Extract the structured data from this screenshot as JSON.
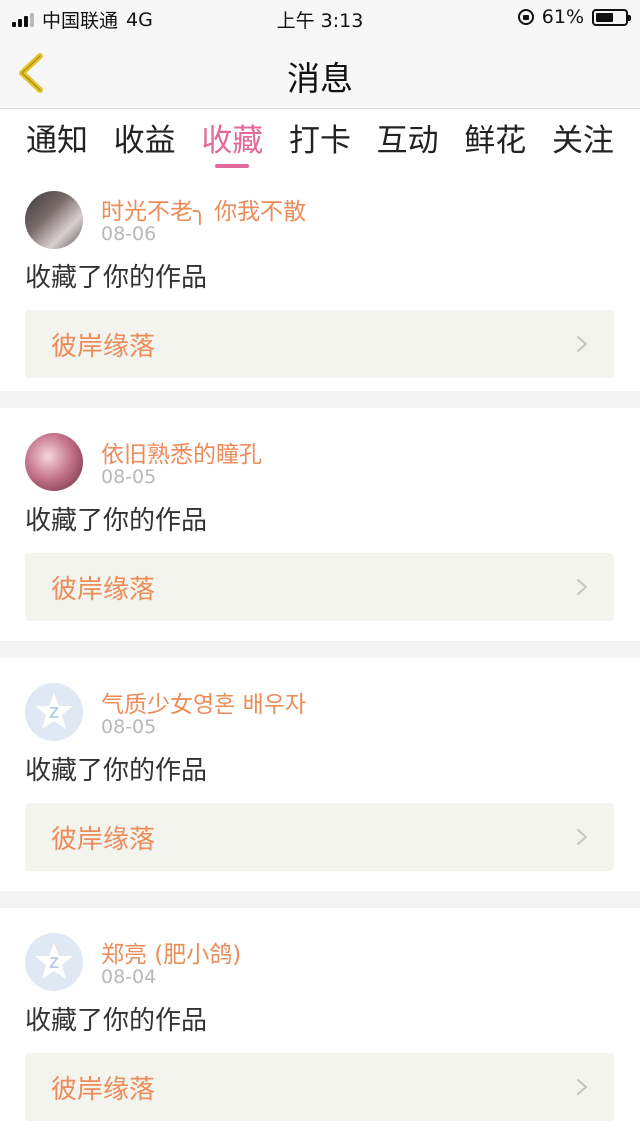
{
  "status": {
    "carrier": "中国联通",
    "network": "4G",
    "time": "上午 3:13",
    "battery_text": "61%",
    "battery_level": 0.61
  },
  "nav": {
    "title": "消息",
    "back_icon": "chevron-left-icon"
  },
  "colors": {
    "accent": "#e26a9a",
    "name": "#ec8c5a",
    "back_arrow": "#e6c229"
  },
  "tabs": [
    {
      "label": "通知",
      "active": false
    },
    {
      "label": "收益",
      "active": false
    },
    {
      "label": "收藏",
      "active": true
    },
    {
      "label": "打卡",
      "active": false
    },
    {
      "label": "互动",
      "active": false
    },
    {
      "label": "鲜花",
      "active": false
    },
    {
      "label": "关注",
      "active": false
    }
  ],
  "items": [
    {
      "name": "时光不老╮ 你我不散",
      "date": "08-06",
      "action": "收藏了你的作品",
      "work": "彼岸缘落",
      "avatar": "photo"
    },
    {
      "name": "依旧熟悉的瞳孔",
      "date": "08-05",
      "action": "收藏了你的作品",
      "work": "彼岸缘落",
      "avatar": "photo"
    },
    {
      "name": "气质少女영혼 배우자",
      "date": "08-05",
      "action": "收藏了你的作品",
      "work": "彼岸缘落",
      "avatar": "default"
    },
    {
      "name": "郑亮 (肥小鸽)",
      "date": "08-04",
      "action": "收藏了你的作品",
      "work": "彼岸缘落",
      "avatar": "default"
    }
  ]
}
